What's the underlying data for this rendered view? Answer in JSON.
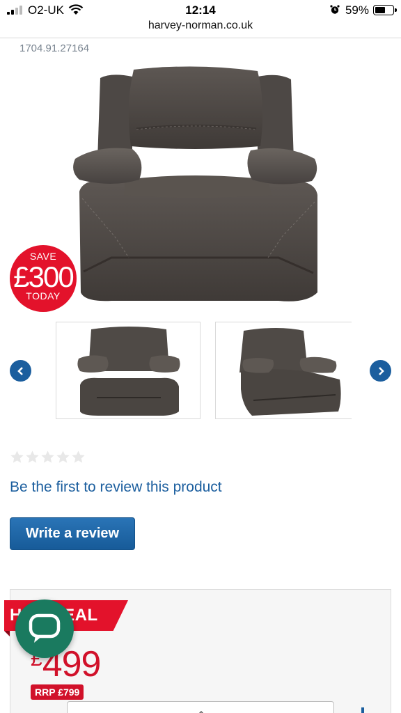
{
  "status_bar": {
    "carrier": "O2-UK",
    "time": "12:14",
    "battery_percent": "59%",
    "battery_level": 0.59
  },
  "browser": {
    "url": "harvey-norman.co.uk"
  },
  "product": {
    "sku": "1704.91.27164",
    "save_badge": {
      "line1": "SAVE",
      "amount": "£300",
      "line3": "TODAY"
    }
  },
  "reviews": {
    "rating": 0,
    "max_rating": 5,
    "prompt": "Be the first to review this product",
    "write_review_label": "Write a review"
  },
  "pricing": {
    "deal_label": "HOT DEAL",
    "currency": "£",
    "price": "499",
    "rrp": "RRP £799"
  },
  "colors": {
    "brand_blue": "#1b5e9e",
    "sale_red": "#e3122b",
    "chat_green": "#1a7a5f"
  },
  "icons": {
    "carousel_prev": "chevron-left-icon",
    "carousel_next": "chevron-right-icon",
    "chat": "chat-bubble-icon"
  }
}
